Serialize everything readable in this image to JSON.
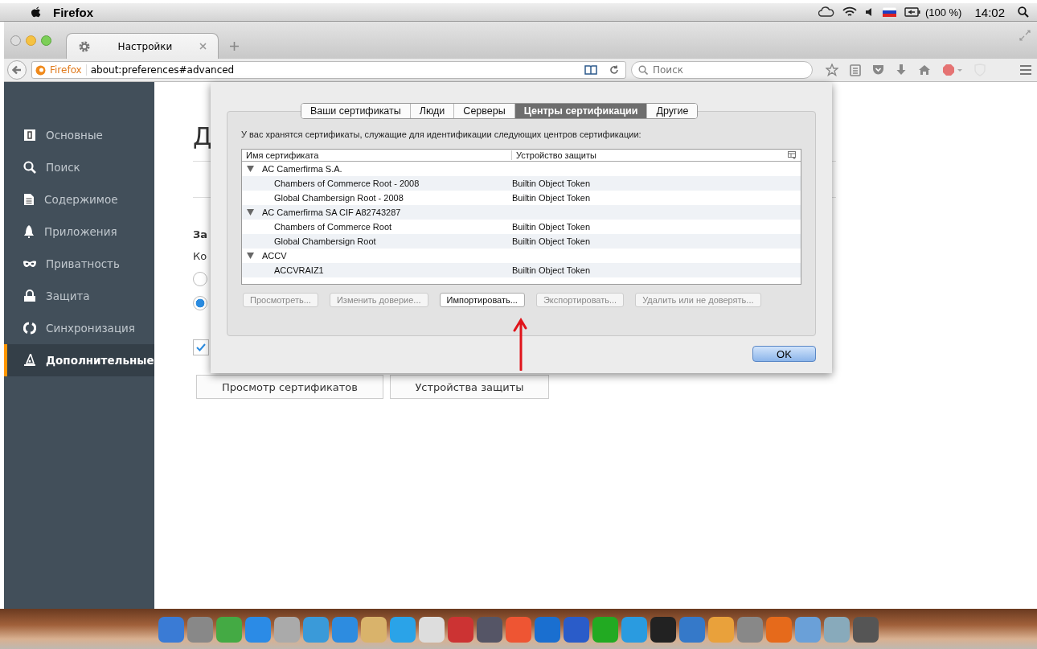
{
  "menubar": {
    "app": "Firefox",
    "battery": "(100 %)",
    "clock": "14:02"
  },
  "tabs": [
    {
      "label": "Настройки",
      "selected": true
    }
  ],
  "navbar": {
    "site": "Firefox",
    "url": "about:preferences#advanced",
    "search": {
      "placeholder": "Поиск"
    }
  },
  "sidebar": {
    "items": [
      {
        "label": "Основные",
        "selected": false
      },
      {
        "label": "Поиск",
        "selected": false
      },
      {
        "label": "Содержимое",
        "selected": false
      },
      {
        "label": "Приложения",
        "selected": false
      },
      {
        "label": "Приватность",
        "selected": false
      },
      {
        "label": "Защита",
        "selected": false
      },
      {
        "label": "Синхронизация",
        "selected": false
      },
      {
        "label": "Дополнительные",
        "selected": true
      }
    ]
  },
  "page": {
    "heading": "Д",
    "section": "За",
    "line": "Ко",
    "radios": [
      {
        "selected": false
      },
      {
        "selected": true
      }
    ],
    "ocsp_checkbox": {
      "checked": true
    },
    "buttons": [
      "Просмотр сертификатов",
      "Устройства защиты"
    ]
  },
  "dialog": {
    "tabs": [
      {
        "label": "Ваши сертификаты",
        "selected": false
      },
      {
        "label": "Люди",
        "selected": false
      },
      {
        "label": "Серверы",
        "selected": false
      },
      {
        "label": "Центры сертификации",
        "selected": true
      },
      {
        "label": "Другие",
        "selected": false
      }
    ],
    "description": "У вас хранятся сертификаты, служащие для идентификации следующих центров сертификации:",
    "columns": [
      "Имя сертификата",
      "Устройство защиты"
    ],
    "tree": [
      {
        "name": "AC Camerfirma S.A.",
        "expanded": true,
        "children": [
          {
            "name": "Chambers of Commerce Root - 2008",
            "device": "Builtin Object Token"
          },
          {
            "name": "Global Chambersign Root - 2008",
            "device": "Builtin Object Token"
          }
        ]
      },
      {
        "name": "AC Camerfirma SA CIF A82743287",
        "expanded": true,
        "children": [
          {
            "name": "Chambers of Commerce Root",
            "device": "Builtin Object Token"
          },
          {
            "name": "Global Chambersign Root",
            "device": "Builtin Object Token"
          }
        ]
      },
      {
        "name": "ACCV",
        "expanded": true,
        "children": [
          {
            "name": "ACCVRAIZ1",
            "device": "Builtin Object Token"
          }
        ]
      }
    ],
    "actions": [
      {
        "label": "Просмотреть...",
        "disabled": true
      },
      {
        "label": "Изменить доверие...",
        "disabled": true
      },
      {
        "label": "Импортировать...",
        "disabled": false
      },
      {
        "label": "Экспортировать...",
        "disabled": true
      },
      {
        "label": "Удалить или не доверять...",
        "disabled": true
      }
    ],
    "ok": "OK"
  }
}
